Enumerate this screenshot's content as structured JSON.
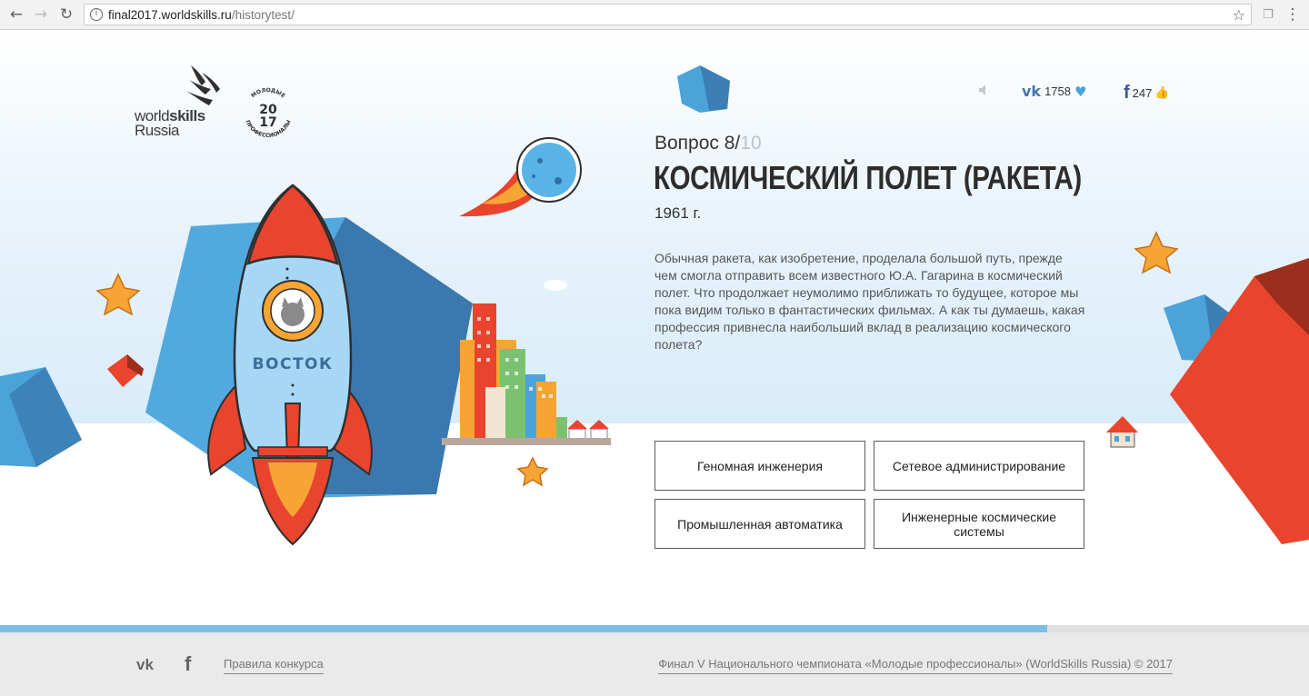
{
  "browser": {
    "url_host": "final2017.worldskills.ru",
    "url_path": "/historytest/",
    "back_icon": "arrow-left-icon",
    "forward_icon": "arrow-right-icon",
    "reload_icon": "reload-icon",
    "bookmark_icon": "star-icon",
    "menu_icon": "dots-vertical-icon"
  },
  "header": {
    "logo_text_1": "world",
    "logo_text_2": "skills",
    "logo_text_3": "Russia",
    "badge_top": "МОЛОДЫЕ",
    "badge_year_1": "20",
    "badge_year_2": "17",
    "badge_bottom": "ПРОФЕССИОНАЛЫ",
    "vk_count": "1758",
    "fb_count": "247"
  },
  "question": {
    "label": "Вопрос 8/",
    "total": "10",
    "title": "КОСМИЧЕСКИЙ ПОЛЕТ (РАКЕТА)",
    "year": "1961 г.",
    "text": "Обычная ракета, как изобретение, проделала большой путь, прежде чем смогла отправить всем известного Ю.А. Гагарина в космический полет. Что продолжает неумолимо приближать то будущее, которое мы пока видим только в фантастических фильмах. А как ты думаешь, какая профессия привнесла наибольший вклад в реализацию космического полета?",
    "answers": [
      "Геномная инженерия",
      "Сетевое администрирование",
      "Промышленная автоматика",
      "Инженерные космические системы"
    ]
  },
  "illustration": {
    "rocket_label": "ВОСТОК"
  },
  "progress": {
    "fraction": 0.8
  },
  "footer": {
    "rules": "Правила конкурса",
    "copyright": "Финал V Национального чемпионата «Молодые профессионалы» (WorldSkills Russia) © 2017"
  },
  "colors": {
    "accent_blue": "#7bc0e3",
    "rocket_red": "#e8442e",
    "cube_blue": "#4ba3d9"
  }
}
